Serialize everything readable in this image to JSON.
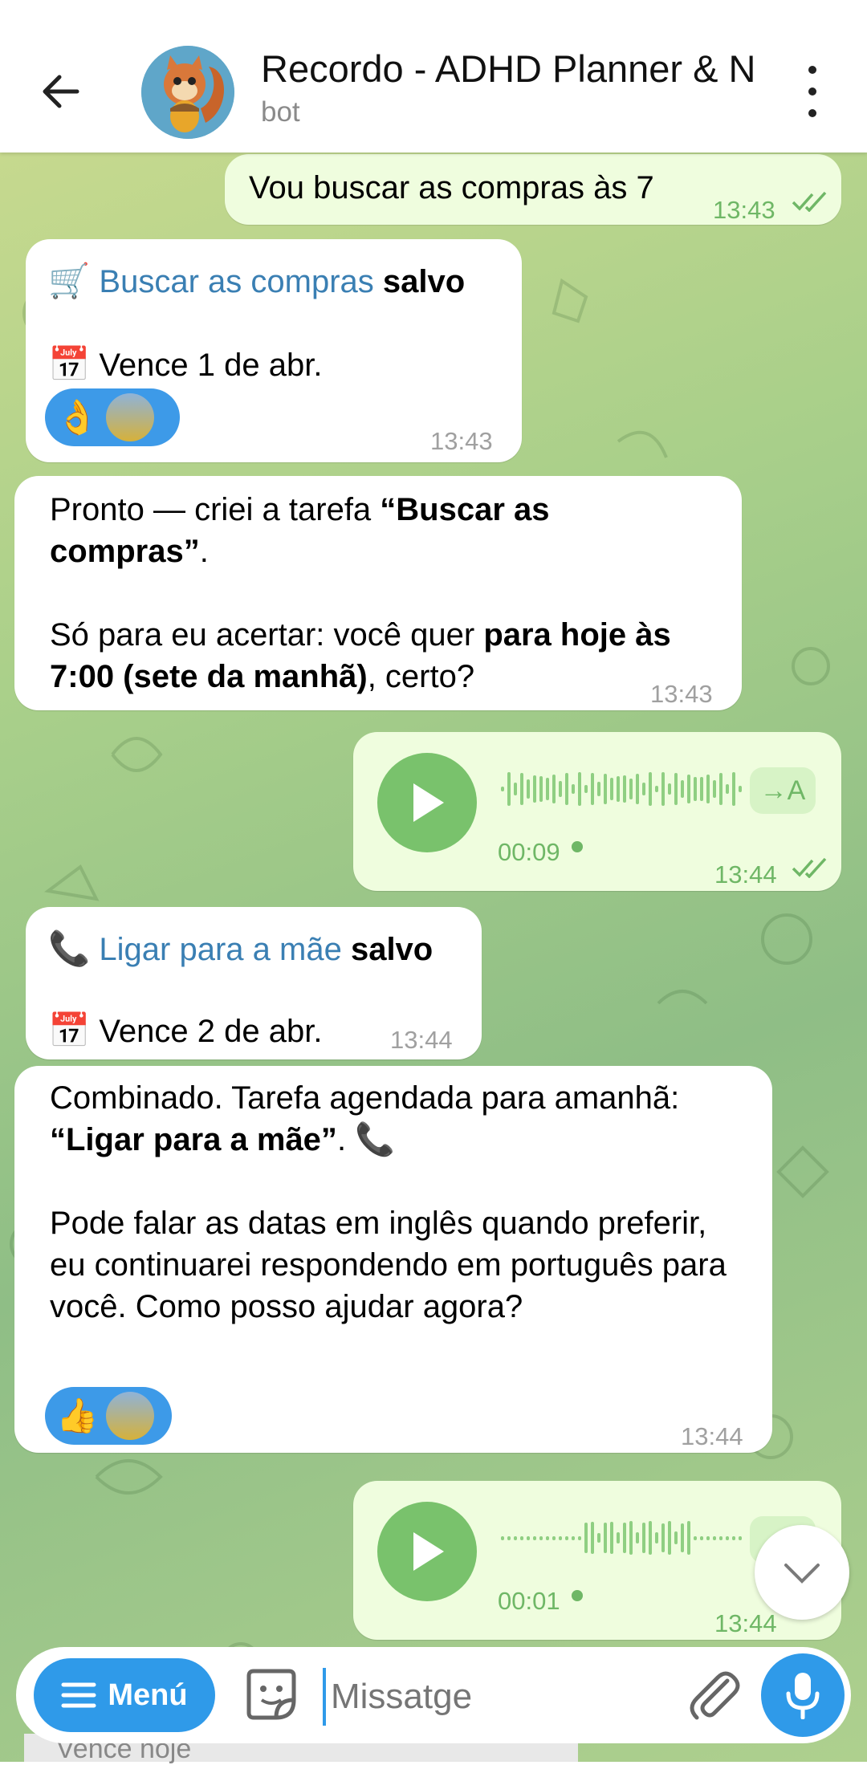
{
  "header": {
    "title": "Recordo - ADHD Planner & N",
    "subtitle": "bot",
    "back_icon": "arrow-left-icon",
    "more_icon": "more-vertical-icon"
  },
  "messages": {
    "m1": {
      "text": "Vou buscar as compras às 7",
      "time": "13:43"
    },
    "m2": {
      "emoji": "🛒",
      "task": "Buscar as compras",
      "saved": "salvo",
      "cal_emoji": "📅",
      "due": "Vence 1 de abr.",
      "reaction": "👌",
      "time": "13:43"
    },
    "m3": {
      "p1a": "Pronto — criei a tarefa ",
      "p1b": "“Buscar as compras”",
      "p1c": ".",
      "p2a": "Só para eu acertar: você quer ",
      "p2b": "para hoje às 7:00 (sete da manhã)",
      "p2c": ", certo?",
      "time": "13:43"
    },
    "m4": {
      "duration": "00:09",
      "transcribe": "→A",
      "time": "13:44"
    },
    "m5": {
      "emoji": "📞",
      "task": "Ligar para a mãe",
      "saved": "salvo",
      "cal_emoji": "📅",
      "due": "Vence 2 de abr.",
      "time": "13:44"
    },
    "m6": {
      "p1a": "Combinado. Tarefa agendada para amanhã: ",
      "p1b": "“Ligar para a mãe”",
      "p1c": ". 📞",
      "p2": "Pode falar as datas em inglês quando preferir, eu continuarei respondendo em português para você. Como posso ajudar agora?",
      "reaction": "👍",
      "time": "13:44"
    },
    "m7": {
      "duration": "00:01",
      "transcribe": "→A",
      "time": "13:44"
    }
  },
  "composer": {
    "menu_label": "Menú",
    "placeholder": "Missatge",
    "underlay_text": "Vence hoje"
  },
  "colors": {
    "accent": "#2f9ae9",
    "out_bubble": "#effdde",
    "in_bubble": "#ffffff",
    "link": "#3a7fb3"
  }
}
